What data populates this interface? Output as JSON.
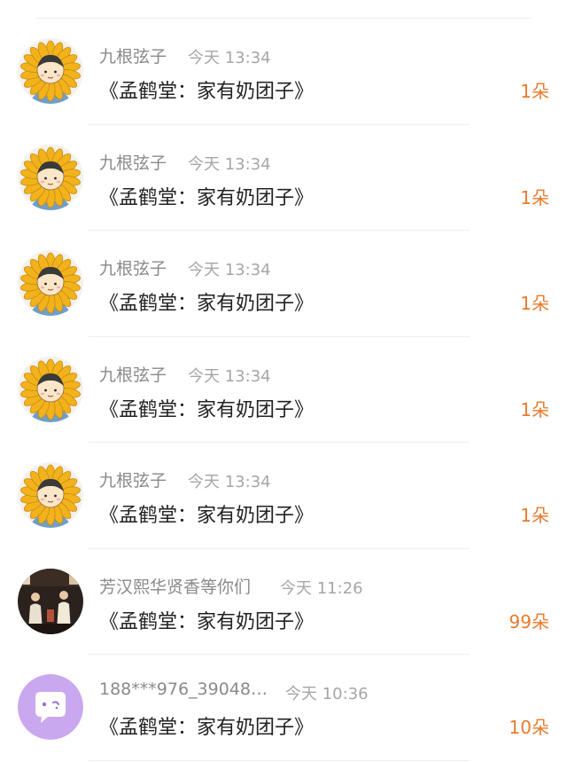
{
  "gifts": [
    {
      "avatar": "sunflower-boy-avatar",
      "name": "九根弦子",
      "time": "今天 13:34",
      "title": "《孟鹤堂：家有奶团子》",
      "count": "1朵"
    },
    {
      "avatar": "sunflower-boy-avatar",
      "name": "九根弦子",
      "time": "今天 13:34",
      "title": "《孟鹤堂：家有奶团子》",
      "count": "1朵"
    },
    {
      "avatar": "sunflower-boy-avatar",
      "name": "九根弦子",
      "time": "今天 13:34",
      "title": "《孟鹤堂：家有奶团子》",
      "count": "1朵"
    },
    {
      "avatar": "sunflower-boy-avatar",
      "name": "九根弦子",
      "time": "今天 13:34",
      "title": "《孟鹤堂：家有奶团子》",
      "count": "1朵"
    },
    {
      "avatar": "sunflower-boy-avatar",
      "name": "九根弦子",
      "time": "今天 13:34",
      "title": "《孟鹤堂：家有奶团子》",
      "count": "1朵"
    },
    {
      "avatar": "stage-photo-avatar",
      "name": "芳汉熙华贤香等你们",
      "time": "今天 11:26",
      "title": "《孟鹤堂：家有奶团子》",
      "count": "99朵"
    },
    {
      "avatar": "chat-bubble-avatar",
      "name": "188***976_39048…",
      "time": "今天 10:36",
      "title": "《孟鹤堂：家有奶团子》",
      "count": "10朵"
    }
  ],
  "colors": {
    "count": "#e97a2c",
    "name": "#8a8a8a",
    "time": "#a6a6a6",
    "title": "#222222",
    "divider": "#eeeeee",
    "sunflower_petal": "#f2b21b",
    "chat_avatar_bg": "#c9a8f0"
  }
}
